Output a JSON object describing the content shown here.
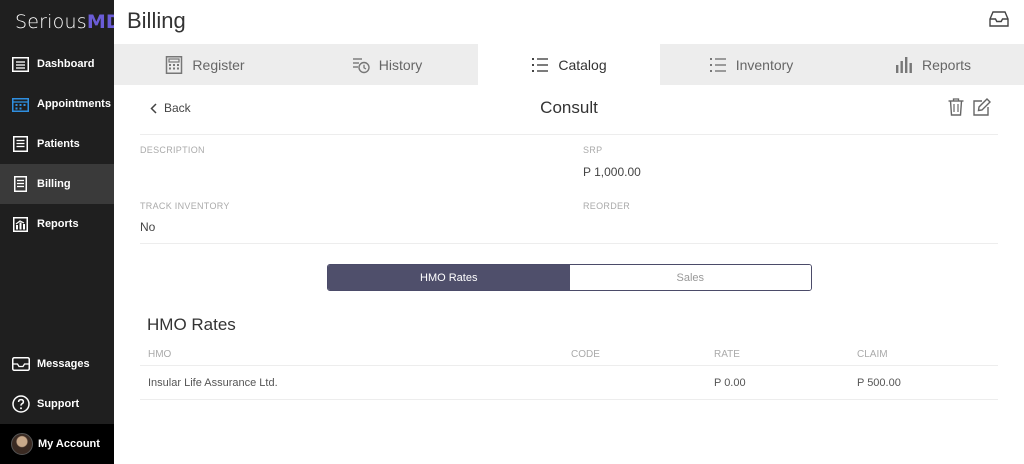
{
  "app": {
    "logo_text": "Serious",
    "logo_accent": "MD",
    "accent_color": "#4f4f6b"
  },
  "sidebar": {
    "items": [
      {
        "label": "Dashboard",
        "icon": "dashboard-icon"
      },
      {
        "label": "Appointments",
        "icon": "calendar-icon"
      },
      {
        "label": "Patients",
        "icon": "patients-icon"
      },
      {
        "label": "Billing",
        "icon": "billing-icon",
        "active": true
      },
      {
        "label": "Reports",
        "icon": "reports-icon"
      }
    ],
    "bottom": [
      {
        "label": "Messages",
        "icon": "messages-icon"
      },
      {
        "label": "Support",
        "icon": "help-icon"
      },
      {
        "label": "My Account",
        "icon": "avatar"
      }
    ]
  },
  "header": {
    "title": "Billing"
  },
  "tabs": [
    {
      "label": "Register",
      "icon": "register-icon"
    },
    {
      "label": "History",
      "icon": "history-icon"
    },
    {
      "label": "Catalog",
      "icon": "list-icon",
      "active": true
    },
    {
      "label": "Inventory",
      "icon": "list-icon"
    },
    {
      "label": "Reports",
      "icon": "bar-chart-icon"
    }
  ],
  "detail": {
    "back_label": "Back",
    "title": "Consult",
    "fields": {
      "description": {
        "label": "DESCRIPTION",
        "value": ""
      },
      "srp": {
        "label": "SRP",
        "value": "P 1,000.00"
      },
      "track_inventory": {
        "label": "TRACK INVENTORY",
        "value": "No"
      },
      "reorder": {
        "label": "REORDER",
        "value": ""
      }
    }
  },
  "segmented": {
    "options": [
      "HMO Rates",
      "Sales"
    ],
    "selected": "HMO Rates"
  },
  "hmo_section": {
    "title": "HMO Rates",
    "columns": [
      "HMO",
      "CODE",
      "RATE",
      "CLAIM"
    ],
    "rows": [
      {
        "hmo": "Insular Life Assurance Ltd.",
        "code": "",
        "rate": "P 0.00",
        "claim": "P 500.00"
      }
    ]
  }
}
